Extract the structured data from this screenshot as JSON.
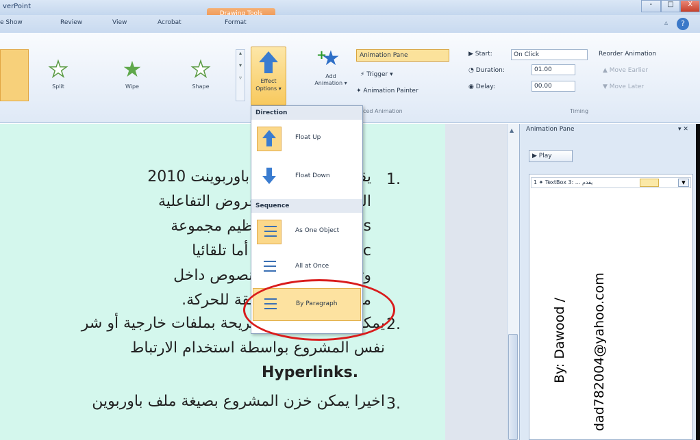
{
  "window": {
    "app_title": "verPoint",
    "contextual_tab": "Drawing Tools",
    "controls": {
      "minimize": "-",
      "restore": "□",
      "close": "X"
    }
  },
  "tabs": [
    "e Show",
    "Review",
    "View",
    "Acrobat",
    "Format"
  ],
  "ribbon": {
    "effects": [
      {
        "label": "Split",
        "icon": "split-star-icon"
      },
      {
        "label": "Wipe",
        "icon": "wipe-star-icon"
      },
      {
        "label": "Shape",
        "icon": "shape-star-icon"
      }
    ],
    "effect_options": {
      "line1": "Effect",
      "line2": "Options ▾"
    },
    "add_animation": {
      "line1": "Add",
      "line2": "Animation ▾"
    },
    "advanced": {
      "animation_pane": "Animation Pane",
      "trigger": "Trigger ▾",
      "animation_painter": "Animation Painter",
      "group_label": "ced Animation"
    },
    "timing": {
      "start_label": "Start:",
      "start_value": "On Click",
      "duration_label": "Duration:",
      "duration_value": "01.00",
      "delay_label": "Delay:",
      "delay_value": "00.00",
      "reorder_label": "Reorder Animation",
      "move_earlier": "Move Earlier",
      "move_later": "Move Later",
      "group_label": "Timing"
    }
  },
  "dropdown": {
    "direction_header": "Direction",
    "float_up": "Float Up",
    "float_down": "Float Down",
    "sequence_header": "Sequence",
    "as_one_object": "As One Object",
    "all_at_once": "All at Once",
    "by_paragraph": "By Paragraph"
  },
  "slide": {
    "item1_num": "1.",
    "line1": "يقدم مايكروسوفت باوربوينت 2010",
    "line2": "الكثير ة في إعداد عروض التفاعلية",
    "line3": "s يمكن بواسطته تنظيم مجموعة",
    "line4": "utomatic متعاقب أما تلقائيا",
    "line5": "وتنظيم الاشكال والنصوص داخل",
    "line6": "مؤثرات صوتية مرافقة للحركة.",
    "item2_num": "2.",
    "line7": "يمكن ربط عناصر الشريحة بملفات خارجية أو شر",
    "line8": "نفس المشروع بواسطة استخدام الارتباط",
    "line9": "Hyperlinks.",
    "item3_num": "3.",
    "line10": "اخيرا يمكن خزن المشروع بصيغة ملف باوربوين"
  },
  "animation_pane": {
    "title": "Animation Pane",
    "play": "Play",
    "entry": "1 ✦ TextBox 3: ... يقدم"
  },
  "watermark": {
    "by": "By: Dawood /",
    "email": "dad782004@yahoo.com"
  }
}
